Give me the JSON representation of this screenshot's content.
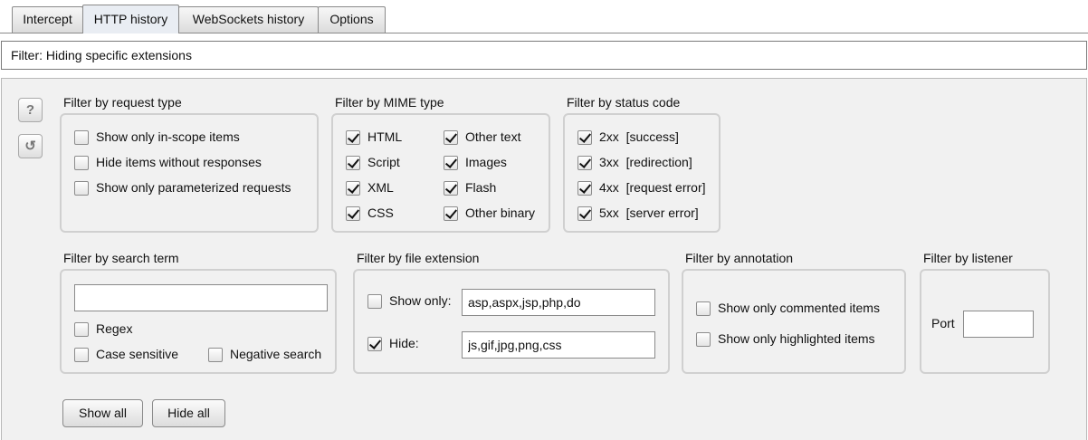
{
  "tabs": [
    {
      "label": "Intercept",
      "active": false
    },
    {
      "label": "HTTP history",
      "active": true
    },
    {
      "label": "WebSockets history",
      "active": false
    },
    {
      "label": "Options",
      "active": false
    }
  ],
  "filter_bar": {
    "text": "Filter: Hiding specific extensions"
  },
  "side_buttons": {
    "help_glyph": "?",
    "reset_glyph": "↺"
  },
  "request_type": {
    "title": "Filter by request type",
    "items": [
      {
        "label": "Show only in-scope items",
        "checked": false
      },
      {
        "label": "Hide items without responses",
        "checked": false
      },
      {
        "label": "Show only parameterized requests",
        "checked": false
      }
    ]
  },
  "mime_type": {
    "title": "Filter by MIME type",
    "items": [
      {
        "label": "HTML",
        "checked": true
      },
      {
        "label": "Other text",
        "checked": true
      },
      {
        "label": "Script",
        "checked": true
      },
      {
        "label": "Images",
        "checked": true
      },
      {
        "label": "XML",
        "checked": true
      },
      {
        "label": "Flash",
        "checked": true
      },
      {
        "label": "CSS",
        "checked": true
      },
      {
        "label": "Other binary",
        "checked": true
      }
    ]
  },
  "status_code": {
    "title": "Filter by status code",
    "items": [
      {
        "label": "2xx  [success]",
        "checked": true
      },
      {
        "label": "3xx  [redirection]",
        "checked": true
      },
      {
        "label": "4xx  [request error]",
        "checked": true
      },
      {
        "label": "5xx  [server error]",
        "checked": true
      }
    ]
  },
  "search_term": {
    "title": "Filter by search term",
    "value": "",
    "regex": {
      "label": "Regex",
      "checked": false
    },
    "case_sensitive": {
      "label": "Case sensitive",
      "checked": false
    },
    "negative": {
      "label": "Negative search",
      "checked": false
    }
  },
  "file_extension": {
    "title": "Filter by file extension",
    "show_only": {
      "label": "Show only:",
      "checked": false,
      "value": "asp,aspx,jsp,php,do"
    },
    "hide": {
      "label": "Hide:",
      "checked": true,
      "value": "js,gif,jpg,png,css"
    }
  },
  "annotation": {
    "title": "Filter by annotation",
    "items": [
      {
        "label": "Show only commented items",
        "checked": false
      },
      {
        "label": "Show only highlighted items",
        "checked": false
      }
    ]
  },
  "listener": {
    "title": "Filter by listener",
    "port_label": "Port",
    "port_value": ""
  },
  "buttons": {
    "show_all": "Show all",
    "hide_all": "Hide all"
  }
}
